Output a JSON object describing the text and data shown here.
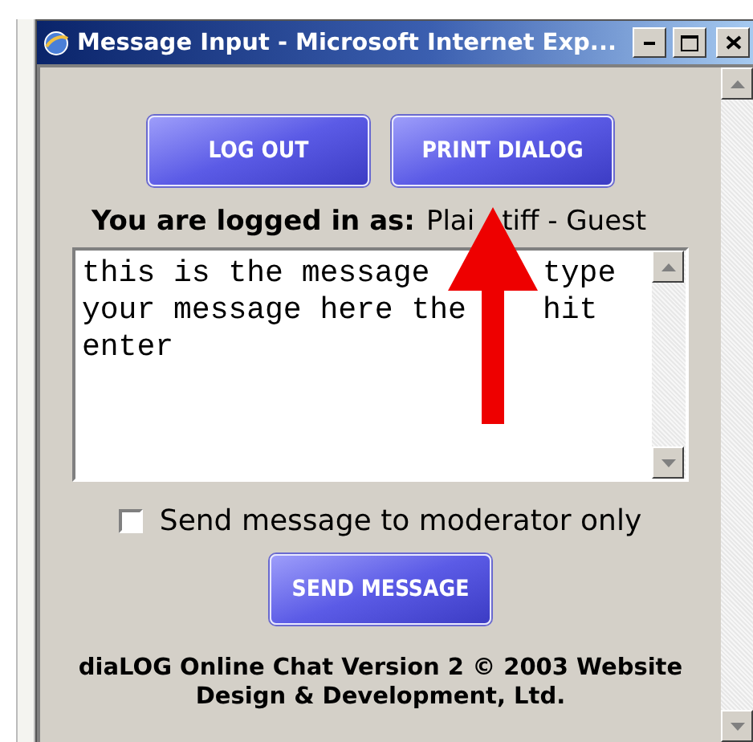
{
  "window": {
    "title": "Message Input - Microsoft Internet Exp..."
  },
  "top_buttons": [
    {
      "label": "LOG OUT"
    },
    {
      "label": "PRINT DIALOG"
    }
  ],
  "login": {
    "label": "You are logged in as:",
    "user_parts": [
      "Plai",
      "tiff - Guest"
    ]
  },
  "message": {
    "lines": [
      [
        "this is the message",
        "type"
      ],
      [
        "your message here the",
        "hit"
      ],
      [
        "enter"
      ]
    ]
  },
  "moderator_only": {
    "label": "Send message to moderator only",
    "checked": false
  },
  "send_button": {
    "label": "SEND MESSAGE"
  },
  "footer": [
    "diaLOG Online Chat Version 2 © 2003 Website",
    "Design & Development, Ltd."
  ]
}
